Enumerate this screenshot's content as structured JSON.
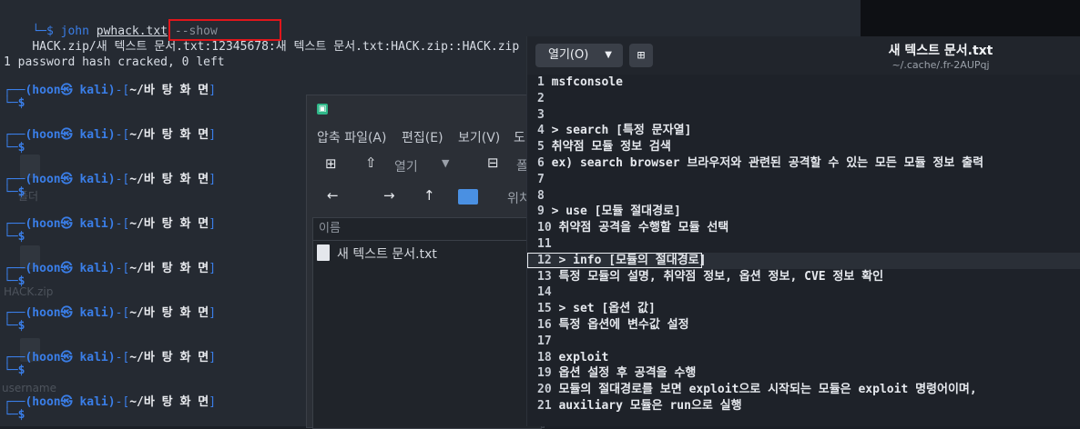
{
  "terminal": {
    "cmd_partial": "└─$ john",
    "cmd_file": "pwhack.txt",
    "cmd_flag": "--show",
    "result_prefix": "HACK.zip/새 텍스트 문서",
    "result_highlight": ".txt:12345678:",
    "result_suffix": "새 텍스트 문서.txt:HACK.zip::HACK.zip",
    "cracked": "1 password hash cracked, 0 left",
    "prompt_user": "(hoon㉿ kali)",
    "prompt_dir": "~/바 탕 화 면",
    "prompt_dollar": "$",
    "ghost_labels": [
      "폴더",
      "HACK.zip",
      "username"
    ]
  },
  "file_manager": {
    "menus": [
      "압축 파일(A)",
      "편집(E)",
      "보기(V)",
      "도"
    ],
    "open_label": "열기",
    "location_label": "위치",
    "column_name": "이름",
    "files": [
      "새 텍스트 문서.txt"
    ],
    "partial_label": "폴"
  },
  "editor": {
    "open_button": "열기(O)",
    "title": "새 텍스트 문서.txt",
    "path": "~/.cache/.fr-2AUPqj",
    "current_line": 12,
    "lines": [
      "msfconsole",
      "",
      "",
      "> search [특정 문자열]",
      "취약점 모듈 정보 검색",
      "ex) search browser 브라우저와 관련된 공격할 수 있는 모든 모듈 정보 출력",
      "",
      "",
      "> use [모듈 절대경로]",
      "취약점 공격을 수행할 모듈 선택",
      "",
      "> info [모듈의 절대경로]",
      "특정 모듈의 설명, 취약점 정보, 옵션 정보, CVE 정보 확인",
      "",
      "> set [옵션 값]",
      "특정 옵션에 변수값 설정",
      "",
      "exploit",
      "옵션 설정 후 공격을 수행",
      "모듈의 절대경로를 보면 exploit으로 시작되는 모듈은 exploit 명령어이며,",
      "auxiliary 모듈은 run으로 실행"
    ]
  }
}
